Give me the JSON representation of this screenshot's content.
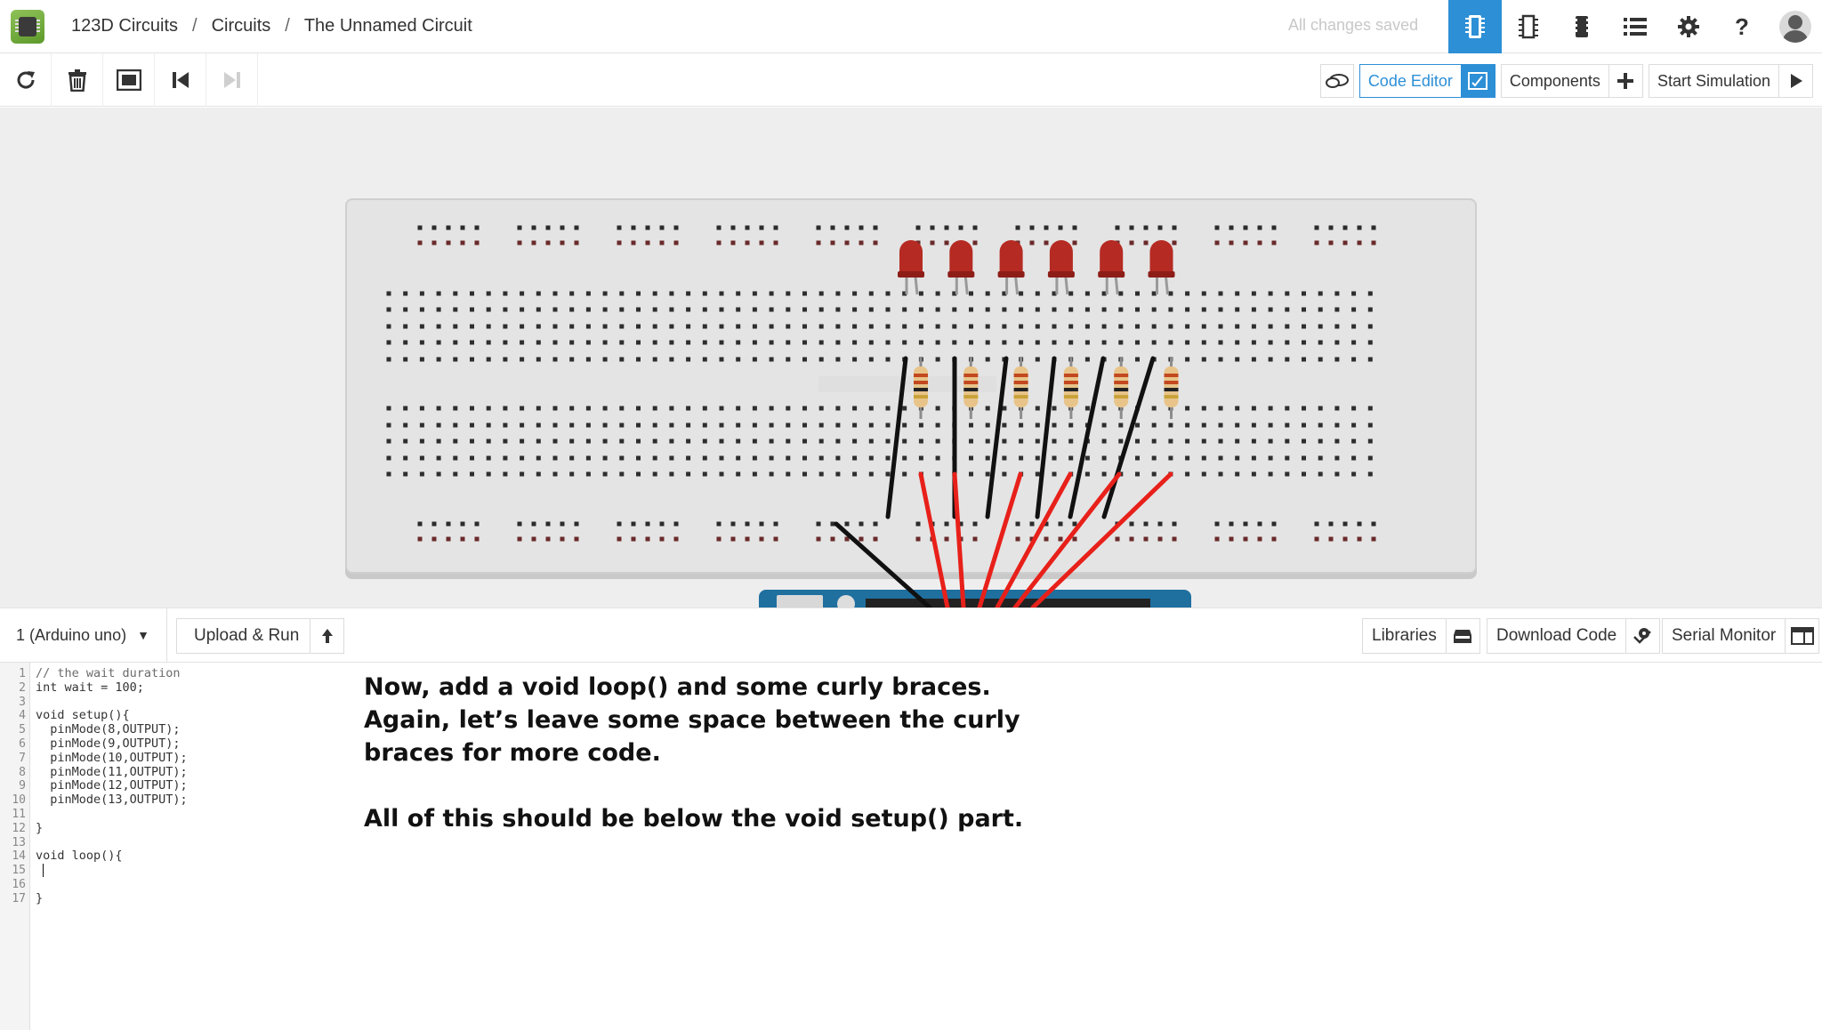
{
  "header": {
    "breadcrumb": [
      "123D Circuits",
      "Circuits",
      "The Unnamed Circuit"
    ],
    "breadcrumb_separator": "/",
    "save_status": "All changes saved",
    "icons": [
      "breadboard-icon",
      "schematic-icon",
      "pcb-icon",
      "parts-list-icon",
      "settings-icon",
      "help-icon",
      "user-avatar-icon"
    ],
    "help_glyph": "?"
  },
  "toolbar": {
    "left_icons": [
      "rotate-icon",
      "delete-icon",
      "fit-view-icon",
      "step-back-icon",
      "step-forward-icon"
    ],
    "code_editor_label": "Code Editor",
    "components_label": "Components",
    "start_simulation_label": "Start Simulation"
  },
  "codebar": {
    "board_select": "1 (Arduino uno)",
    "upload_run_label": "Upload & Run",
    "libraries_label": "Libraries",
    "download_code_label": "Download Code",
    "serial_monitor_label": "Serial Monitor"
  },
  "editor": {
    "lines": [
      "// the wait duration",
      "int wait = 100;",
      "",
      "void setup(){",
      "  pinMode(8,OUTPUT);",
      "  pinMode(9,OUTPUT);",
      "  pinMode(10,OUTPUT);",
      "  pinMode(11,OUTPUT);",
      "  pinMode(12,OUTPUT);",
      "  pinMode(13,OUTPUT);",
      "",
      "}",
      "",
      "void loop(){",
      "",
      "",
      "}"
    ]
  },
  "instructions": {
    "paragraph1": "Now, add a void loop() and some curly braces. Again, let’s leave some space between the curly braces for more code.",
    "paragraph2": "All of this should be below the void setup() part."
  },
  "breadboard": {
    "watermark": "123D.CIRCUITS.IO",
    "led_count": 6,
    "resistor_count": 6,
    "led_color": "#b52a22",
    "wire_colors": [
      "#111111",
      "#e8201a"
    ]
  },
  "colors": {
    "accent": "#2d8fd6",
    "canvas_bg": "#eeeeee"
  }
}
